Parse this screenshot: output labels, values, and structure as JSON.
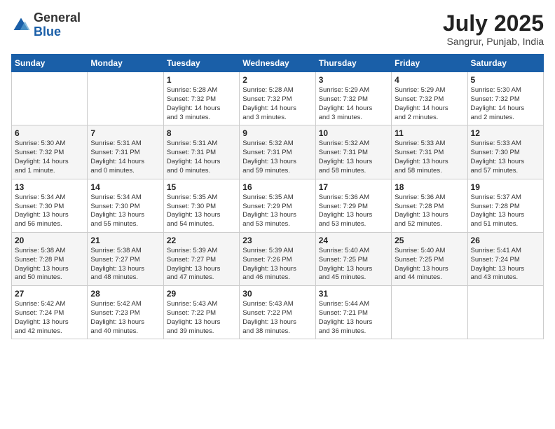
{
  "header": {
    "logo_general": "General",
    "logo_blue": "Blue",
    "month_year": "July 2025",
    "location": "Sangrur, Punjab, India"
  },
  "weekdays": [
    "Sunday",
    "Monday",
    "Tuesday",
    "Wednesday",
    "Thursday",
    "Friday",
    "Saturday"
  ],
  "weeks": [
    [
      {
        "day": "",
        "info": ""
      },
      {
        "day": "",
        "info": ""
      },
      {
        "day": "1",
        "info": "Sunrise: 5:28 AM\nSunset: 7:32 PM\nDaylight: 14 hours\nand 3 minutes."
      },
      {
        "day": "2",
        "info": "Sunrise: 5:28 AM\nSunset: 7:32 PM\nDaylight: 14 hours\nand 3 minutes."
      },
      {
        "day": "3",
        "info": "Sunrise: 5:29 AM\nSunset: 7:32 PM\nDaylight: 14 hours\nand 3 minutes."
      },
      {
        "day": "4",
        "info": "Sunrise: 5:29 AM\nSunset: 7:32 PM\nDaylight: 14 hours\nand 2 minutes."
      },
      {
        "day": "5",
        "info": "Sunrise: 5:30 AM\nSunset: 7:32 PM\nDaylight: 14 hours\nand 2 minutes."
      }
    ],
    [
      {
        "day": "6",
        "info": "Sunrise: 5:30 AM\nSunset: 7:32 PM\nDaylight: 14 hours\nand 1 minute."
      },
      {
        "day": "7",
        "info": "Sunrise: 5:31 AM\nSunset: 7:31 PM\nDaylight: 14 hours\nand 0 minutes."
      },
      {
        "day": "8",
        "info": "Sunrise: 5:31 AM\nSunset: 7:31 PM\nDaylight: 14 hours\nand 0 minutes."
      },
      {
        "day": "9",
        "info": "Sunrise: 5:32 AM\nSunset: 7:31 PM\nDaylight: 13 hours\nand 59 minutes."
      },
      {
        "day": "10",
        "info": "Sunrise: 5:32 AM\nSunset: 7:31 PM\nDaylight: 13 hours\nand 58 minutes."
      },
      {
        "day": "11",
        "info": "Sunrise: 5:33 AM\nSunset: 7:31 PM\nDaylight: 13 hours\nand 58 minutes."
      },
      {
        "day": "12",
        "info": "Sunrise: 5:33 AM\nSunset: 7:30 PM\nDaylight: 13 hours\nand 57 minutes."
      }
    ],
    [
      {
        "day": "13",
        "info": "Sunrise: 5:34 AM\nSunset: 7:30 PM\nDaylight: 13 hours\nand 56 minutes."
      },
      {
        "day": "14",
        "info": "Sunrise: 5:34 AM\nSunset: 7:30 PM\nDaylight: 13 hours\nand 55 minutes."
      },
      {
        "day": "15",
        "info": "Sunrise: 5:35 AM\nSunset: 7:30 PM\nDaylight: 13 hours\nand 54 minutes."
      },
      {
        "day": "16",
        "info": "Sunrise: 5:35 AM\nSunset: 7:29 PM\nDaylight: 13 hours\nand 53 minutes."
      },
      {
        "day": "17",
        "info": "Sunrise: 5:36 AM\nSunset: 7:29 PM\nDaylight: 13 hours\nand 53 minutes."
      },
      {
        "day": "18",
        "info": "Sunrise: 5:36 AM\nSunset: 7:28 PM\nDaylight: 13 hours\nand 52 minutes."
      },
      {
        "day": "19",
        "info": "Sunrise: 5:37 AM\nSunset: 7:28 PM\nDaylight: 13 hours\nand 51 minutes."
      }
    ],
    [
      {
        "day": "20",
        "info": "Sunrise: 5:38 AM\nSunset: 7:28 PM\nDaylight: 13 hours\nand 50 minutes."
      },
      {
        "day": "21",
        "info": "Sunrise: 5:38 AM\nSunset: 7:27 PM\nDaylight: 13 hours\nand 48 minutes."
      },
      {
        "day": "22",
        "info": "Sunrise: 5:39 AM\nSunset: 7:27 PM\nDaylight: 13 hours\nand 47 minutes."
      },
      {
        "day": "23",
        "info": "Sunrise: 5:39 AM\nSunset: 7:26 PM\nDaylight: 13 hours\nand 46 minutes."
      },
      {
        "day": "24",
        "info": "Sunrise: 5:40 AM\nSunset: 7:25 PM\nDaylight: 13 hours\nand 45 minutes."
      },
      {
        "day": "25",
        "info": "Sunrise: 5:40 AM\nSunset: 7:25 PM\nDaylight: 13 hours\nand 44 minutes."
      },
      {
        "day": "26",
        "info": "Sunrise: 5:41 AM\nSunset: 7:24 PM\nDaylight: 13 hours\nand 43 minutes."
      }
    ],
    [
      {
        "day": "27",
        "info": "Sunrise: 5:42 AM\nSunset: 7:24 PM\nDaylight: 13 hours\nand 42 minutes."
      },
      {
        "day": "28",
        "info": "Sunrise: 5:42 AM\nSunset: 7:23 PM\nDaylight: 13 hours\nand 40 minutes."
      },
      {
        "day": "29",
        "info": "Sunrise: 5:43 AM\nSunset: 7:22 PM\nDaylight: 13 hours\nand 39 minutes."
      },
      {
        "day": "30",
        "info": "Sunrise: 5:43 AM\nSunset: 7:22 PM\nDaylight: 13 hours\nand 38 minutes."
      },
      {
        "day": "31",
        "info": "Sunrise: 5:44 AM\nSunset: 7:21 PM\nDaylight: 13 hours\nand 36 minutes."
      },
      {
        "day": "",
        "info": ""
      },
      {
        "day": "",
        "info": ""
      }
    ]
  ]
}
